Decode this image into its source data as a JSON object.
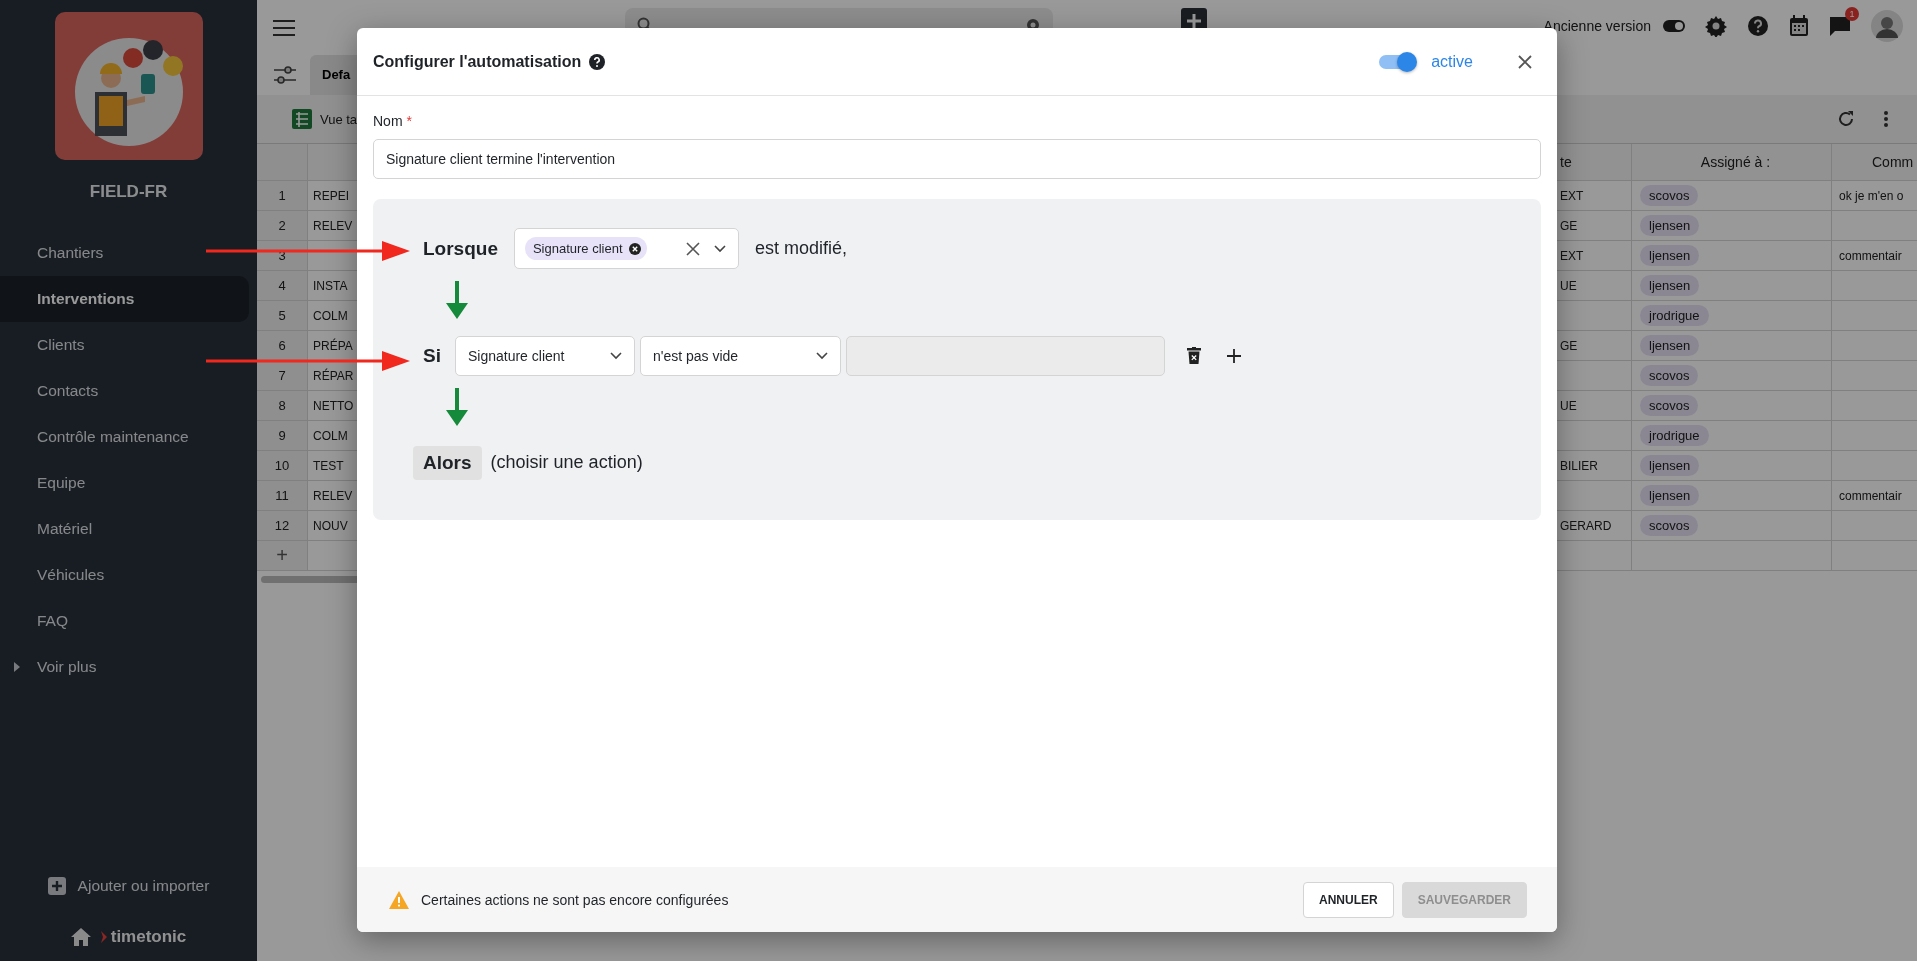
{
  "sidebar": {
    "workspace": "FIELD-FR",
    "items": [
      {
        "label": "Chantiers",
        "selected": false
      },
      {
        "label": "Interventions",
        "selected": true
      },
      {
        "label": "Clients",
        "selected": false
      },
      {
        "label": "Contacts",
        "selected": false
      },
      {
        "label": "Contrôle maintenance",
        "selected": false
      },
      {
        "label": "Equipe",
        "selected": false
      },
      {
        "label": "Matériel",
        "selected": false
      },
      {
        "label": "Véhicules",
        "selected": false
      },
      {
        "label": "FAQ",
        "selected": false
      }
    ],
    "more": "Voir plus",
    "add": "Ajouter ou importer",
    "brand": "timetonic"
  },
  "topbar": {
    "legacy_label": "Ancienne version",
    "legacy_on": true,
    "notification_count": "1"
  },
  "view": {
    "tab": "Defa",
    "view_label": "Vue ta"
  },
  "table": {
    "columns": [
      "te",
      "Assigné à :",
      "Comm"
    ],
    "rows": [
      {
        "number": "1",
        "column_2": "REPEI",
        "column_3": "EXT",
        "assigned_to": "scovos",
        "column_5": "ok je m'en o"
      },
      {
        "number": "2",
        "column_2": "RELEV",
        "column_3": "GE",
        "assigned_to": "ljensen"
      },
      {
        "number": "3",
        "column_3": "EXT",
        "assigned_to": "ljensen",
        "column_5": "commentair"
      },
      {
        "number": "4",
        "column_2": "INSTA",
        "column_3": "UE",
        "assigned_to": "ljensen"
      },
      {
        "number": "5",
        "column_2": "COLM",
        "assigned_to": "jrodrigue"
      },
      {
        "number": "6",
        "column_2": "PRÉPA",
        "column_3": "GE",
        "assigned_to": "ljensen"
      },
      {
        "number": "7",
        "column_2": "RÉPAR",
        "assigned_to": "scovos"
      },
      {
        "number": "8",
        "column_2": "NETTO",
        "column_3": "UE",
        "assigned_to": "scovos"
      },
      {
        "number": "9",
        "column_2": "COLM",
        "assigned_to": "jrodrigue"
      },
      {
        "number": "10",
        "column_2": "TEST",
        "column_3": "BILIER",
        "assigned_to": "ljensen"
      },
      {
        "number": "11",
        "column_2": "RELEV",
        "assigned_to": "ljensen",
        "column_5": "commentair"
      },
      {
        "number": "12",
        "column_2": "NOUV",
        "column_3": "GERARD",
        "assigned_to": "scovos"
      }
    ],
    "add_row": "+"
  },
  "modal": {
    "title": "Configurer l'automatisation",
    "active": true,
    "active_label": "active",
    "name_label": "Nom",
    "required_mark": "*",
    "name_value": "Signature client termine l'intervention",
    "trigger": {
      "keyword": "Lorsque",
      "chip": "Signature client",
      "suffix": "est modifié,"
    },
    "condition": {
      "keyword": "Si",
      "field": "Signature client",
      "operator": "n'est pas vide",
      "value_disabled": true
    },
    "action": {
      "keyword": "Alors",
      "placeholder": "(choisir une action)"
    },
    "footer": {
      "warning": "Certaines actions ne sont pas encore configurées",
      "buttons": [
        {
          "label": "ANNULER",
          "disabled": false
        },
        {
          "label": "SAUVEGARDER",
          "disabled": true
        }
      ]
    }
  }
}
